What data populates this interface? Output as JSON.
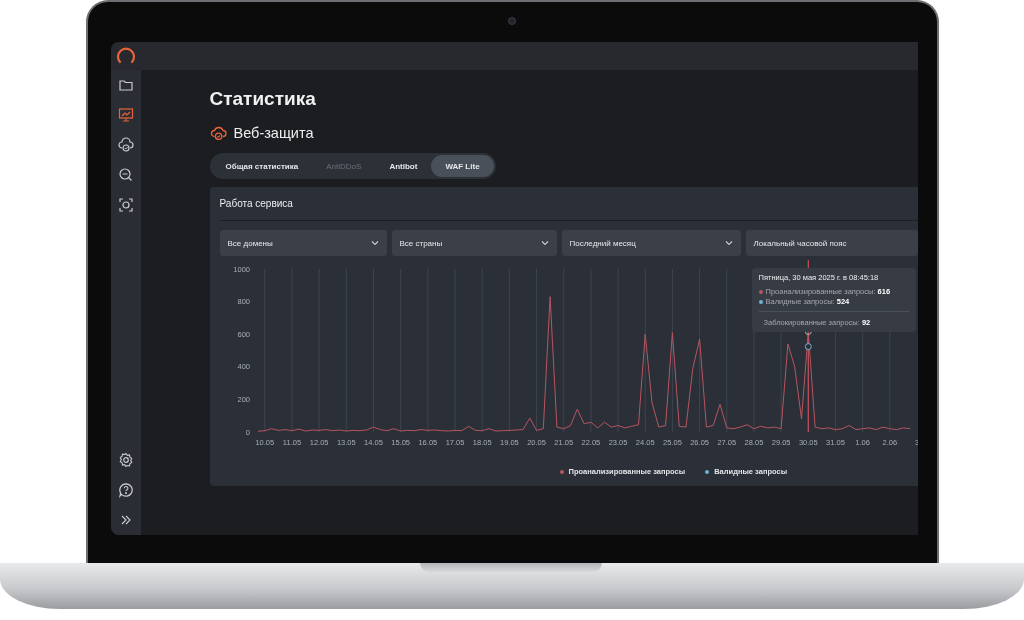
{
  "sidebar": {
    "items": [
      {
        "selected": false
      },
      {
        "selected": true
      },
      {
        "selected": false
      },
      {
        "selected": false
      },
      {
        "selected": false
      }
    ],
    "footer_items": [
      {
        "kind": "settings"
      },
      {
        "kind": "help"
      },
      {
        "kind": "expand"
      }
    ]
  },
  "page": {
    "title": "Статистика",
    "section": "Веб-защита"
  },
  "tabs": [
    {
      "label": "Общая статистика",
      "selected": false,
      "disabled": false
    },
    {
      "label": "AntiDDoS",
      "selected": false,
      "disabled": true
    },
    {
      "label": "Antibot",
      "selected": false,
      "disabled": false
    },
    {
      "label": "WAF Lite",
      "selected": true,
      "disabled": false
    }
  ],
  "card": {
    "title": "Работа сервиса",
    "filters": [
      {
        "value": "Все домены",
        "chevron": true
      },
      {
        "value": "Все страны",
        "chevron": true
      },
      {
        "value": "Последний месяц",
        "chevron": true
      },
      {
        "value": "Локальный часовой пояс",
        "chevron": false
      }
    ],
    "chart_data": {
      "type": "line",
      "grid": true,
      "ylim": [
        0,
        1000
      ],
      "yticks": [
        0,
        200,
        400,
        600,
        800,
        1000
      ],
      "categories": [
        null,
        "10.05",
        null,
        null,
        null,
        "11.05",
        null,
        null,
        null,
        "12.05",
        null,
        null,
        null,
        "13.05",
        null,
        null,
        null,
        "14.05",
        null,
        null,
        null,
        "15.05",
        null,
        null,
        null,
        "16.05",
        null,
        null,
        null,
        "17.05",
        null,
        null,
        null,
        "18.05",
        null,
        null,
        null,
        "19.05",
        null,
        null,
        null,
        "20.05",
        null,
        null,
        null,
        "21.05",
        null,
        null,
        null,
        "22.05",
        null,
        null,
        null,
        "23.05",
        null,
        null,
        null,
        "24.05",
        null,
        null,
        null,
        "25.05",
        null,
        null,
        null,
        "26.05",
        null,
        null,
        null,
        "27.05",
        null,
        null,
        null,
        "28.05",
        null,
        null,
        null,
        "29.05",
        null,
        null,
        null,
        "30.05",
        null,
        null,
        null,
        "31.05",
        null,
        null,
        null,
        "1.06",
        null,
        null,
        null,
        "2.06",
        null,
        null,
        null,
        "3"
      ],
      "series": [
        {
          "name": "Проанализированные запросы",
          "color": "#b5555f",
          "values": [
            5,
            8,
            20,
            10,
            15,
            8,
            18,
            6,
            12,
            10,
            15,
            8,
            12,
            6,
            10,
            8,
            12,
            30,
            15,
            8,
            20,
            6,
            10,
            8,
            15,
            10,
            12,
            8,
            6,
            10,
            8,
            35,
            10,
            8,
            20,
            6,
            8,
            10,
            12,
            15,
            85,
            10,
            20,
            830,
            30,
            20,
            40,
            140,
            50,
            60,
            25,
            60,
            30,
            40,
            25,
            35,
            45,
            600,
            180,
            30,
            40,
            610,
            35,
            30,
            390,
            570,
            30,
            40,
            170,
            25,
            20,
            30,
            45,
            20,
            35,
            25,
            30,
            20,
            540,
            400,
            80,
            616,
            30,
            20,
            25,
            15,
            20,
            40,
            15,
            20,
            25,
            15,
            30,
            20,
            15,
            25,
            20,
            null
          ]
        },
        {
          "name": "Валидные запросы",
          "color": "#6fb3d6",
          "marker": "circle",
          "values": [
            null,
            null,
            null,
            null,
            null,
            null,
            null,
            null,
            null,
            null,
            null,
            null,
            null,
            null,
            null,
            null,
            null,
            null,
            null,
            null,
            null,
            null,
            null,
            null,
            null,
            null,
            null,
            null,
            null,
            null,
            null,
            null,
            null,
            null,
            null,
            null,
            null,
            null,
            null,
            null,
            null,
            null,
            null,
            null,
            null,
            null,
            null,
            null,
            null,
            null,
            null,
            null,
            null,
            null,
            null,
            null,
            null,
            null,
            null,
            null,
            null,
            null,
            null,
            null,
            null,
            null,
            null,
            null,
            null,
            null,
            null,
            null,
            null,
            null,
            null,
            null,
            null,
            null,
            null,
            null,
            null,
            524,
            null,
            null,
            null,
            null,
            null,
            null,
            null,
            null,
            null,
            null,
            null,
            null,
            null,
            null,
            null,
            null
          ]
        }
      ]
    },
    "tooltip": {
      "title": "Пятница, 30 мая 2025 г. в 08:45:18",
      "lines": [
        {
          "text": "Проанализированные запросы: **616**",
          "color": "#b5555f"
        },
        {
          "text": "Валидные запросы: **524**",
          "color": "#6fb3d6"
        }
      ],
      "footer": "Заблокированные запросы: **92**"
    }
  }
}
